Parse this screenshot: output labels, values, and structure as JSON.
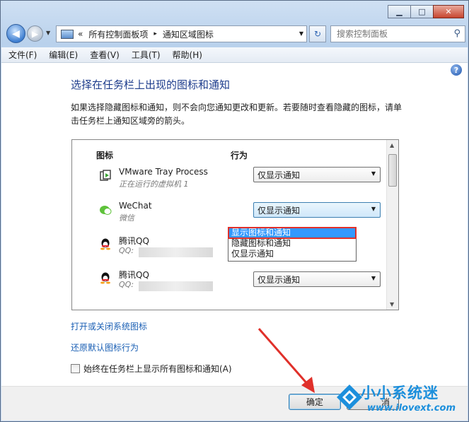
{
  "window": {
    "caption": {
      "minimize": "▁",
      "maximize": "□",
      "close": "✕"
    }
  },
  "address_bar": {
    "prefix": "«",
    "path": [
      "所有控制面板项",
      "通知区域图标"
    ],
    "separator": "▸",
    "search_placeholder": "搜索控制面板"
  },
  "menu": [
    "文件(F)",
    "编辑(E)",
    "查看(V)",
    "工具(T)",
    "帮助(H)"
  ],
  "content": {
    "heading": "选择在任务栏上出现的图标和通知",
    "description": "如果选择隐藏图标和通知，则不会向您通知更改和更新。若要随时查看隐藏的图标，请单击任务栏上通知区域旁的箭头。",
    "columns": {
      "icon": "图标",
      "behavior": "行为"
    },
    "items": [
      {
        "name": "VMware Tray Process",
        "sub": "正在运行的虚拟机 1",
        "behavior": "仅显示通知",
        "icon": "vmware-icon"
      },
      {
        "name": "WeChat",
        "sub": "微信",
        "behavior": "仅显示通知",
        "icon": "wechat-icon"
      },
      {
        "name": "腾讯QQ",
        "sub": "QQ: ",
        "behavior": "仅显示通知",
        "icon": "qq-penguin-icon"
      },
      {
        "name": "腾讯QQ",
        "sub": "QQ: ",
        "behavior": "仅显示通知",
        "icon": "qq-penguin-icon"
      }
    ],
    "dropdown_options": [
      "显示图标和通知",
      "隐藏图标和通知",
      "仅显示通知"
    ],
    "dropdown_selected": "显示图标和通知",
    "links": {
      "system_icons": "打开或关闭系统图标",
      "restore_defaults": "还原默认图标行为"
    },
    "always_show_label": "始终在任务栏上显示所有图标和通知(A)"
  },
  "footer": {
    "ok": "确定",
    "cancel_partial": "消"
  },
  "watermark": {
    "title": "小小系统迷",
    "url": "www.ilovext.com"
  },
  "colors": {
    "accent_link": "#1a5fb4",
    "heading": "#1d3c8c",
    "selection": "#3399ff",
    "highlight_box": "#e0302a",
    "annotation_arrow": "#e0302a"
  }
}
